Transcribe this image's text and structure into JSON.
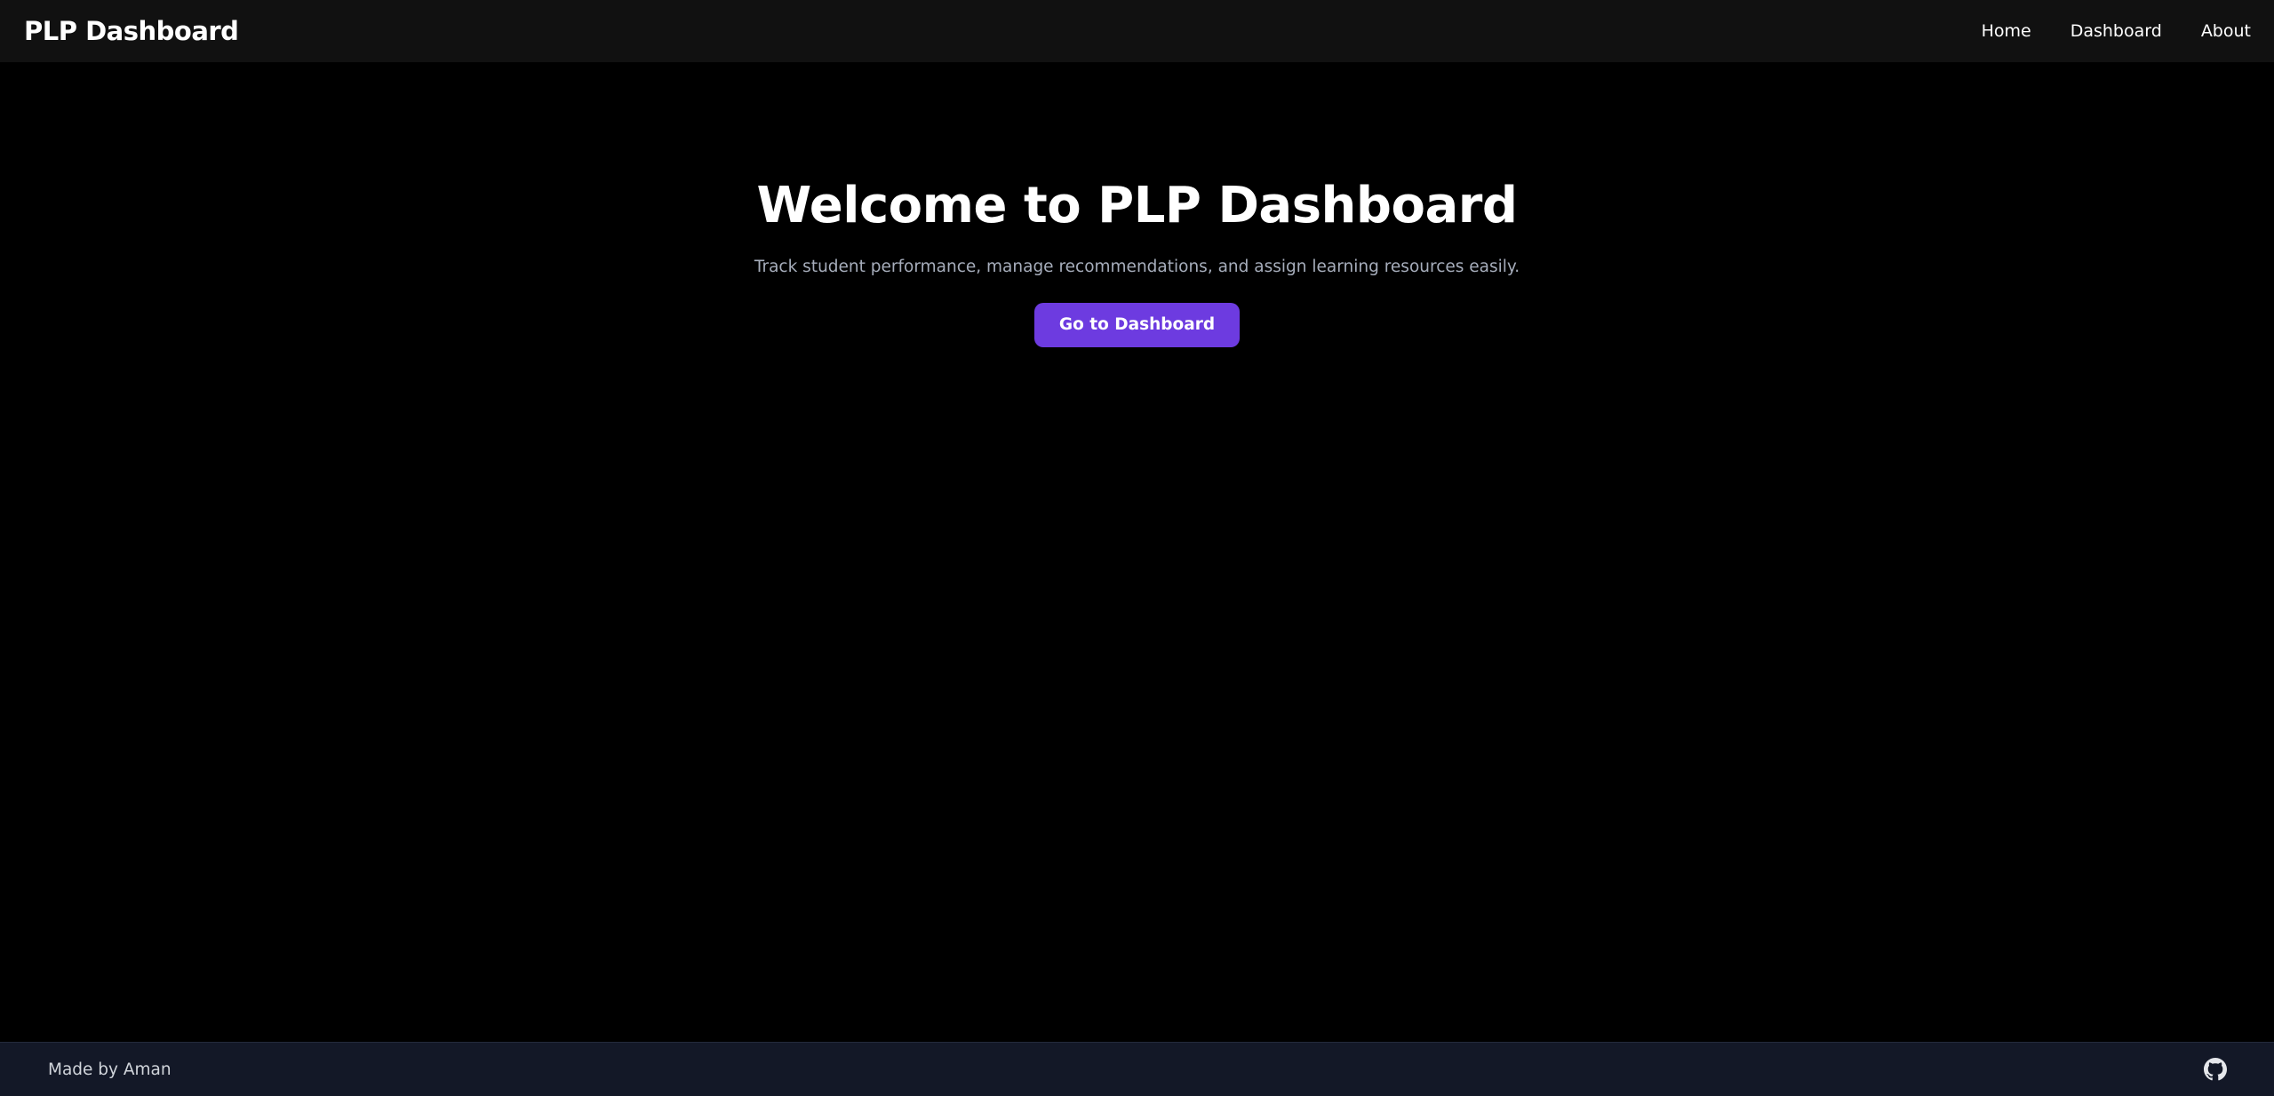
{
  "navbar": {
    "brand": "PLP Dashboard",
    "links": [
      {
        "label": "Home"
      },
      {
        "label": "Dashboard"
      },
      {
        "label": "About"
      }
    ]
  },
  "hero": {
    "title": "Welcome to PLP Dashboard",
    "subtitle": "Track student performance, manage recommendations, and assign learning resources easily.",
    "cta_label": "Go to Dashboard"
  },
  "footer": {
    "credit": "Made by Aman",
    "icon": "github-icon"
  },
  "colors": {
    "background": "#000000",
    "navbar": "#111111",
    "accent": "#6d3be0",
    "footer": "#131827",
    "subtitle": "#a6adbb"
  }
}
